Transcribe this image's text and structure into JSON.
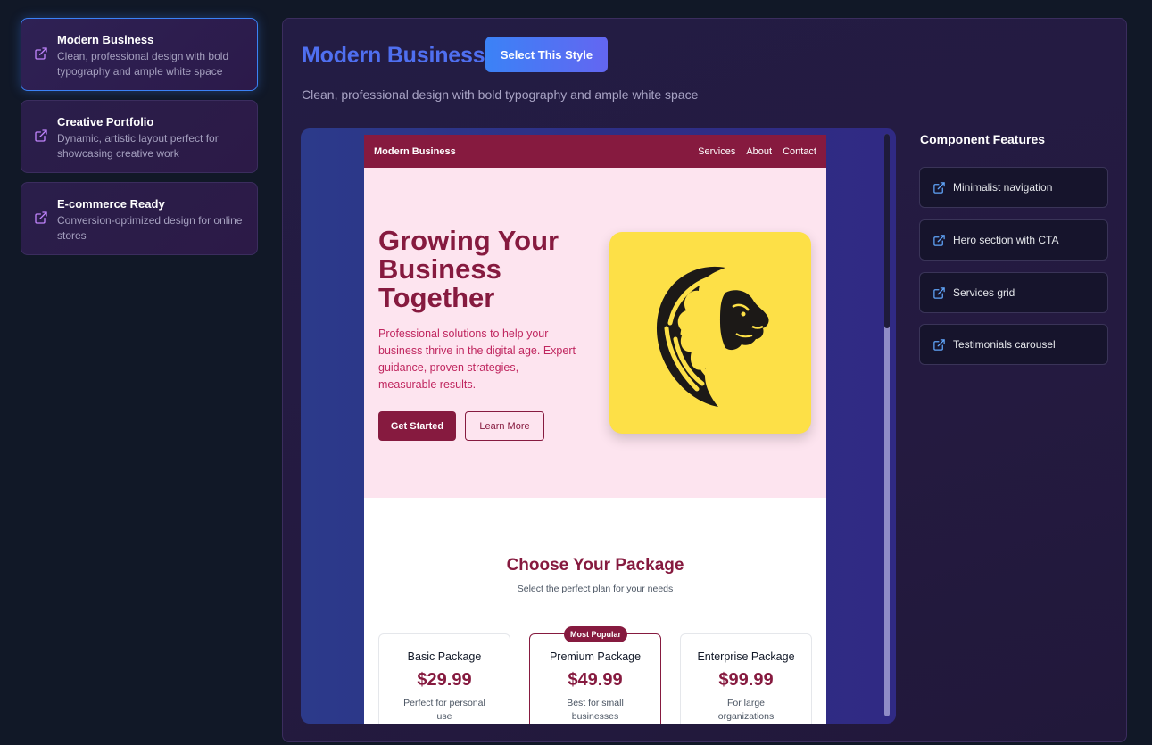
{
  "colors": {
    "accent": "#3b82f6",
    "title_blue": "#4f6ff0",
    "brand_maroon": "#861a3f",
    "hero_bg": "#fde4ef",
    "hero_image_bg": "#fde047",
    "icon_pink": "#c084fc",
    "icon_blue": "#60a5fa"
  },
  "sidebar": {
    "items": [
      {
        "icon": "external-link-icon",
        "title": "Modern Business",
        "description": "Clean, professional design with bold typography and ample white space",
        "active": true
      },
      {
        "icon": "external-link-icon",
        "title": "Creative Portfolio",
        "description": "Dynamic, artistic layout perfect for showcasing creative work",
        "active": false
      },
      {
        "icon": "external-link-icon",
        "title": "E-commerce Ready",
        "description": "Conversion-optimized design for online stores",
        "active": false
      }
    ]
  },
  "main": {
    "title": "Modern Business",
    "select_label": "Select This Style",
    "description": "Clean, professional design with bold typography and ample white space"
  },
  "preview": {
    "nav": {
      "brand": "Modern Business",
      "links": [
        "Services",
        "About",
        "Contact"
      ]
    },
    "hero": {
      "title": "Growing Your Business Together",
      "text": "Professional solutions to help your business thrive in the digital age. Expert guidance, proven strategies, measurable results.",
      "primary_cta": "Get Started",
      "secondary_cta": "Learn More",
      "image_icon": "lion-head-icon"
    },
    "packages": {
      "title": "Choose Your Package",
      "subtitle": "Select the perfect plan for your needs",
      "badge": "Most Popular",
      "items": [
        {
          "name": "Basic Package",
          "price": "$29.99",
          "desc": "Perfect for personal use"
        },
        {
          "name": "Premium Package",
          "price": "$49.99",
          "desc": "Best for small businesses"
        },
        {
          "name": "Enterprise Package",
          "price": "$99.99",
          "desc": "For large organizations"
        }
      ]
    }
  },
  "features": {
    "title": "Component Features",
    "items": [
      {
        "icon": "external-link-icon",
        "label": "Minimalist navigation"
      },
      {
        "icon": "external-link-icon",
        "label": "Hero section with CTA"
      },
      {
        "icon": "external-link-icon",
        "label": "Services grid"
      },
      {
        "icon": "external-link-icon",
        "label": "Testimonials carousel"
      }
    ]
  }
}
